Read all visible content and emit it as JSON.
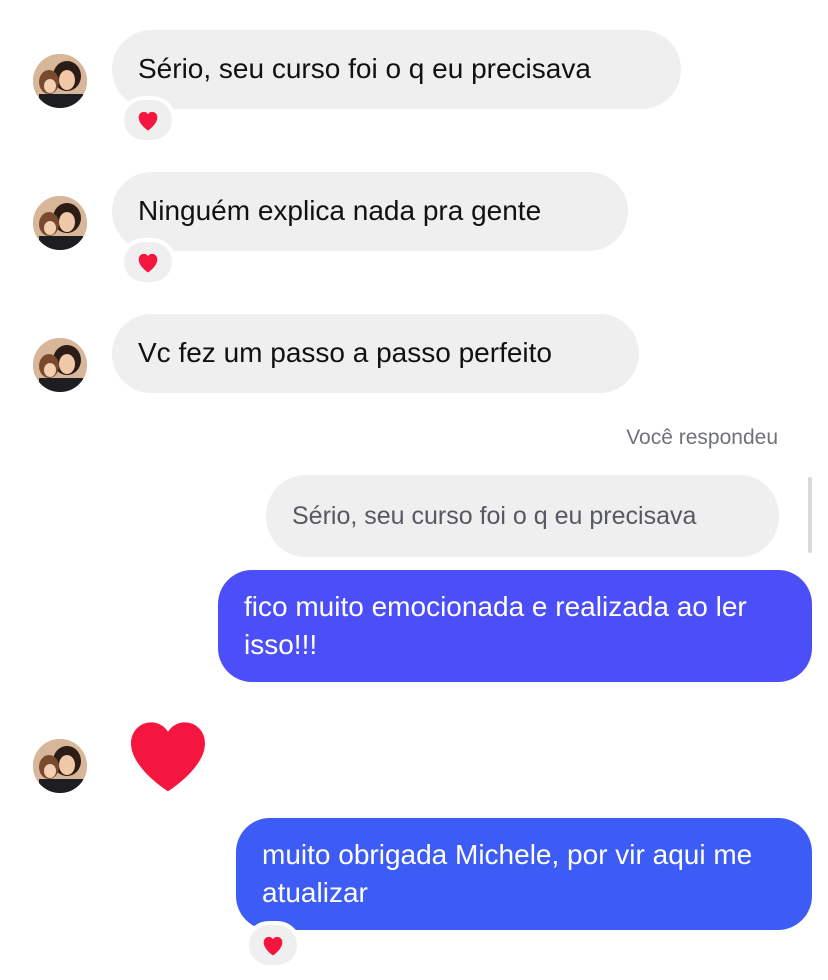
{
  "messages": {
    "m1": {
      "text": "Sério, seu curso foi o q eu precisava",
      "reaction": "red-heart-emoji"
    },
    "m2": {
      "text": "Ninguém explica nada pra gente",
      "reaction": "red-heart-emoji"
    },
    "m3": {
      "text": "Vc fez um passo a passo perfeito"
    },
    "reply_label": "Você respondeu",
    "quoted": "Sério, seu curso foi o q eu precisava",
    "out1": {
      "text": "fico muito emocionada e realizada ao ler isso!!!"
    },
    "big_heart": "large-red-heart",
    "out2": {
      "text": "muito obrigada Michele, por vir aqui me atualizar",
      "reaction": "red-heart-emoji"
    }
  },
  "colors": {
    "incoming_bubble": "#efefef",
    "outgoing_bubble_1": "#4c4ff7",
    "outgoing_bubble_2": "#3d5cf6",
    "heart": "#f4163f"
  }
}
